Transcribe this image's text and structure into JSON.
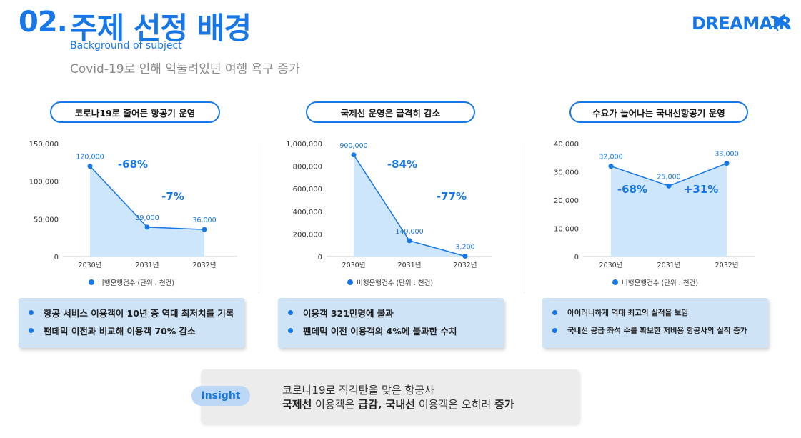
{
  "header": {
    "number": "02.",
    "title": "주제 선정 배경",
    "subtitle_en": "Background of subject",
    "subtitle_ko": "Covid-19로 인해 억눌려있던 여행 욕구 증가"
  },
  "logo": {
    "text": "DREAMAIR"
  },
  "colors": {
    "accent": "#1877e6",
    "fill": "#cde6fb",
    "note_bg": "#cfe3f6",
    "insight_pill": "#bcd8f6"
  },
  "panels": [
    {
      "label": "코로나19로 줄어든 항공기 운영",
      "legend": "비행운행건수 (단위 : 천건)",
      "notes": [
        "항공 서비스 이용객이 10년 중 역대 최저치를 기록",
        "팬데믹 이전과 비교해 이용객 70% 감소"
      ]
    },
    {
      "label": "국제선 운영은 급격히 감소",
      "legend": "비행운행건수 (단위 : 천건)",
      "notes": [
        "이용객 321만명에 불과",
        "팬데믹 이전 이용객의 4%에 불과한 수치"
      ]
    },
    {
      "label": "수요가 늘어나는 국내선항공기 운영",
      "legend": "비행운행건수 (단위 : 천건)",
      "notes": [
        "아이러니하게 역대 최고의 실적을 보임",
        "국내선 공급 좌석 수를 확보한 저비용 항공사의 실적 증가"
      ]
    }
  ],
  "chart_data": [
    {
      "type": "area",
      "categories": [
        "2030년",
        "2031년",
        "2032년"
      ],
      "series": [
        {
          "name": "비행운행건수 (단위 : 천건)",
          "values": [
            120000,
            39000,
            36000
          ]
        }
      ],
      "data_labels": [
        "120,000",
        "39,000",
        "36,000"
      ],
      "yticks": [
        "0",
        "50,000",
        "100,000",
        "150,000"
      ],
      "ylim": [
        0,
        150000
      ],
      "annotations": [
        "-68%",
        "-7%"
      ]
    },
    {
      "type": "area",
      "categories": [
        "2030년",
        "2031년",
        "2032년"
      ],
      "series": [
        {
          "name": "비행운행건수 (단위 : 천건)",
          "values": [
            900000,
            140000,
            3200
          ]
        }
      ],
      "data_labels": [
        "900,000",
        "140,000",
        "3,200"
      ],
      "yticks": [
        "0",
        "200,000",
        "400,000",
        "600,000",
        "800,000",
        "1,000,000"
      ],
      "ylim": [
        0,
        1000000
      ],
      "annotations": [
        "-84%",
        "-77%"
      ]
    },
    {
      "type": "area",
      "categories": [
        "2030년",
        "2031년",
        "2032년"
      ],
      "series": [
        {
          "name": "비행운행건수 (단위 : 천건)",
          "values": [
            32000,
            25000,
            33000
          ]
        }
      ],
      "data_labels": [
        "32,000",
        "25,000",
        "33,000"
      ],
      "yticks": [
        "0",
        "10,000",
        "20,000",
        "30,000",
        "40,000"
      ],
      "ylim": [
        0,
        40000
      ],
      "annotations": [
        "-68%",
        "+31%"
      ]
    }
  ],
  "insight": {
    "label": "Insight",
    "line1": "코로나19로 직격탄을 맞은 항공사",
    "line2_a": "국제선",
    "line2_b": " 이용객은 ",
    "line2_c": "급감, 국내선",
    "line2_d": " 이용객은 오히려 ",
    "line2_e": "증가"
  }
}
